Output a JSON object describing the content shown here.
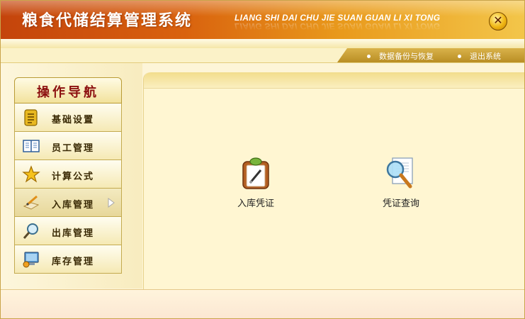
{
  "app": {
    "title": "粮食代储结算管理系统",
    "pinyin": "LIANG SHI DAI CHU JIE SUAN GUAN LI XI TONG"
  },
  "titlebar": {
    "close_icon": "close-icon"
  },
  "toolbar": {
    "backup_label": "数据备份与恢复",
    "exit_label": "退出系统"
  },
  "sidebar": {
    "header": "操作导航",
    "items": [
      {
        "label": "基础设置",
        "icon": "notepad-icon"
      },
      {
        "label": "员工管理",
        "icon": "book-icon"
      },
      {
        "label": "计算公式",
        "icon": "star-icon"
      },
      {
        "label": "入库管理",
        "icon": "pencil-icon",
        "active": true
      },
      {
        "label": "出库管理",
        "icon": "magnifier-icon"
      },
      {
        "label": "库存管理",
        "icon": "computer-icon"
      }
    ]
  },
  "main": {
    "tiles": [
      {
        "label": "入库凭证",
        "icon": "clipboard-pen-icon"
      },
      {
        "label": "凭证查询",
        "icon": "document-search-icon"
      }
    ]
  },
  "colors": {
    "banner_start": "#c4440c",
    "banner_end": "#f3c64a",
    "header_text": "#8c1010",
    "panel_bg": "#fff6d2"
  }
}
